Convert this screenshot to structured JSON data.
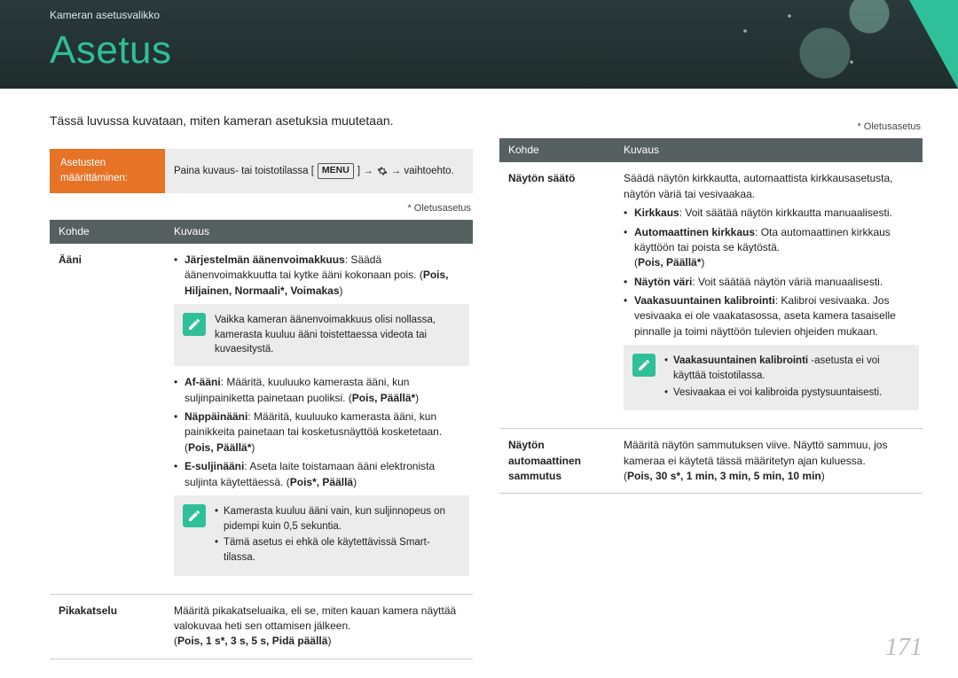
{
  "breadcrumb": "Kameran asetusvalikko",
  "title": "Asetus",
  "intro": "Tässä luvussa kuvataan, miten kameran asetuksia muutetaan.",
  "help": {
    "left": "Asetusten määrittäminen:",
    "right_a": "Paina kuvaus- tai toistotilassa [",
    "menu": "MENU",
    "right_b": "] →",
    "right_c": "→ vaihtoehto."
  },
  "default_note": "* Oletusasetus",
  "headers": {
    "col1": "Kohde",
    "col2": "Kuvaus"
  },
  "left_table": {
    "row1": {
      "name": "Ääni",
      "sys_vol": "Järjestelmän äänenvoimakkuus",
      "sys_vol_desc": ": Säädä äänenvoimakkuutta tai kytke ääni kokonaan pois. (",
      "sys_vol_opts": "Pois, Hiljainen, Normaali*, Voimakas",
      "note1": "Vaikka kameran äänenvoimakkuus olisi nollassa, kamerasta kuuluu ääni toistettaessa videota tai kuvaesitystä.",
      "af": "Af-ääni",
      "af_desc": ": Määritä, kuuluuko kamerasta ääni, kun suljinpainiketta painetaan puoliksi. (",
      "af_opts": "Pois, Päällä*",
      "btn": "Näppäinääni",
      "btn_desc": ": Määritä, kuuluuko kamerasta ääni, kun painikkeita painetaan tai kosketusnäyttöä kosketetaan. (",
      "btn_opts": "Pois, Päällä*",
      "esh": "E-suljinääni",
      "esh_desc": ": Aseta laite toistamaan ääni elektronista suljinta käytettäessä. (",
      "esh_opts": "Pois*, Päällä",
      "note2a": "Kamerasta kuuluu ääni vain, kun suljinnopeus on pidempi kuin 0,5 sekuntia.",
      "note2b": "Tämä asetus ei ehkä ole käytettävissä Smart-tilassa."
    },
    "row2": {
      "name": "Pikakatselu",
      "desc": "Määritä pikakatseluaika, eli se, miten kauan kamera näyttää valokuvaa heti sen ottamisen jälkeen.",
      "opts": "Pois, 1 s*, 3 s, 5 s, Pidä päällä"
    }
  },
  "right_table": {
    "row1": {
      "name": "Näytön säätö",
      "intro": "Säädä näytön kirkkautta, automaattista kirkkausasetusta, näytön väriä tai vesivaakaa.",
      "bright": "Kirkkaus",
      "bright_desc": ": Voit säätää näytön kirkkautta manuaalisesti.",
      "auto": "Automaattinen kirkkaus",
      "auto_desc1": ": Ota automaattinen kirkkaus käyttöön tai poista se käytöstä.",
      "auto_opts": "Pois, Päällä*",
      "color": "Näytön väri",
      "color_desc": ": Voit säätää näytön väriä manuaalisesti.",
      "calib": "Vaakasuuntainen kalibrointi",
      "calib_desc": ": Kalibroi vesivaaka. Jos vesivaaka ei ole vaakatasossa, aseta kamera tasaiselle pinnalle ja toimi näyttöön tulevien ohjeiden mukaan.",
      "note_a": "Vaakasuuntainen kalibrointi",
      "note_a2": " -asetusta ei voi käyttää toistotilassa.",
      "note_b": "Vesivaakaa ei voi kalibroida pystysuuntaisesti."
    },
    "row2": {
      "name": "Näytön automaattinen sammutus",
      "desc": "Määritä näytön sammutuksen viive. Näyttö sammuu, jos kameraa ei käytetä tässä määritetyn ajan kuluessa.",
      "opts": "Pois, 30 s*, 1 min, 3 min, 5 min, 10 min"
    }
  },
  "page_number": "171"
}
